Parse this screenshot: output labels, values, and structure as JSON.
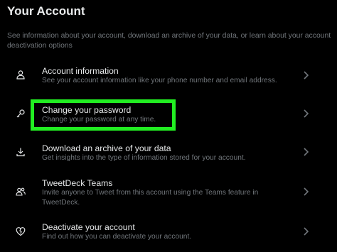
{
  "header": {
    "title": "Your Account",
    "description": "See information about your account, download an archive of your data, or learn about your account deactivation options"
  },
  "items": [
    {
      "label": "Account information",
      "sub": "See your account information like your phone number and email address.",
      "icon": "person-icon"
    },
    {
      "label": "Change your password",
      "sub": "Change your password at any time.",
      "icon": "key-icon"
    },
    {
      "label": "Download an archive of your data",
      "sub": "Get insights into the type of information stored for your account.",
      "icon": "download-icon"
    },
    {
      "label": "TweetDeck Teams",
      "sub": "Invite anyone to Tweet from this account using the Teams feature in TweetDeck.",
      "icon": "people-icon"
    },
    {
      "label": "Deactivate your account",
      "sub": "Find out how you can deactivate your account.",
      "icon": "broken-heart-icon"
    }
  ],
  "colors": {
    "background": "#000000",
    "primary_text": "#e7e9ea",
    "secondary_text": "#71767b",
    "highlight": "#22ee22"
  }
}
